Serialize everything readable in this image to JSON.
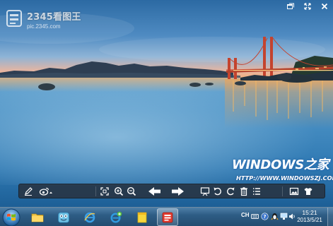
{
  "app": {
    "logo_title": "2345看图王",
    "logo_sub": "pic.2345.com"
  },
  "watermark": {
    "title": "WINDOWS之家",
    "url": "HTTP://WWW.WINDOWSZJ.COM/"
  },
  "window_controls": [
    "restore-icon",
    "fullscreen-icon",
    "close-icon"
  ],
  "toolbar": {
    "buttons": [
      "pen-icon",
      "weibo-share-icon",
      "fit-screen-icon",
      "zoom-in-icon",
      "zoom-out-icon",
      "previous-arrow-icon",
      "next-arrow-icon",
      "slideshow-icon",
      "rotate-left-icon",
      "rotate-right-icon",
      "delete-icon",
      "menu-list-icon",
      "thumbnail-icon",
      "skin-icon"
    ]
  },
  "taskbar": {
    "pinned": [
      "file-explorer-icon",
      "app-frog-icon",
      "internet-explorer-icon",
      "ie-plus-icon",
      "sticky-notes-icon",
      "2345-viewer-icon"
    ],
    "active_index": 5,
    "ime_label": "CH",
    "time": "15:21",
    "date": "2013/5/21"
  },
  "colors": {
    "sky_top": "#2f6fa8",
    "sunset": "#f0a76a",
    "bridge": "#c2402c",
    "water": "#3d86b8",
    "taskbar": "#2e5d85"
  }
}
